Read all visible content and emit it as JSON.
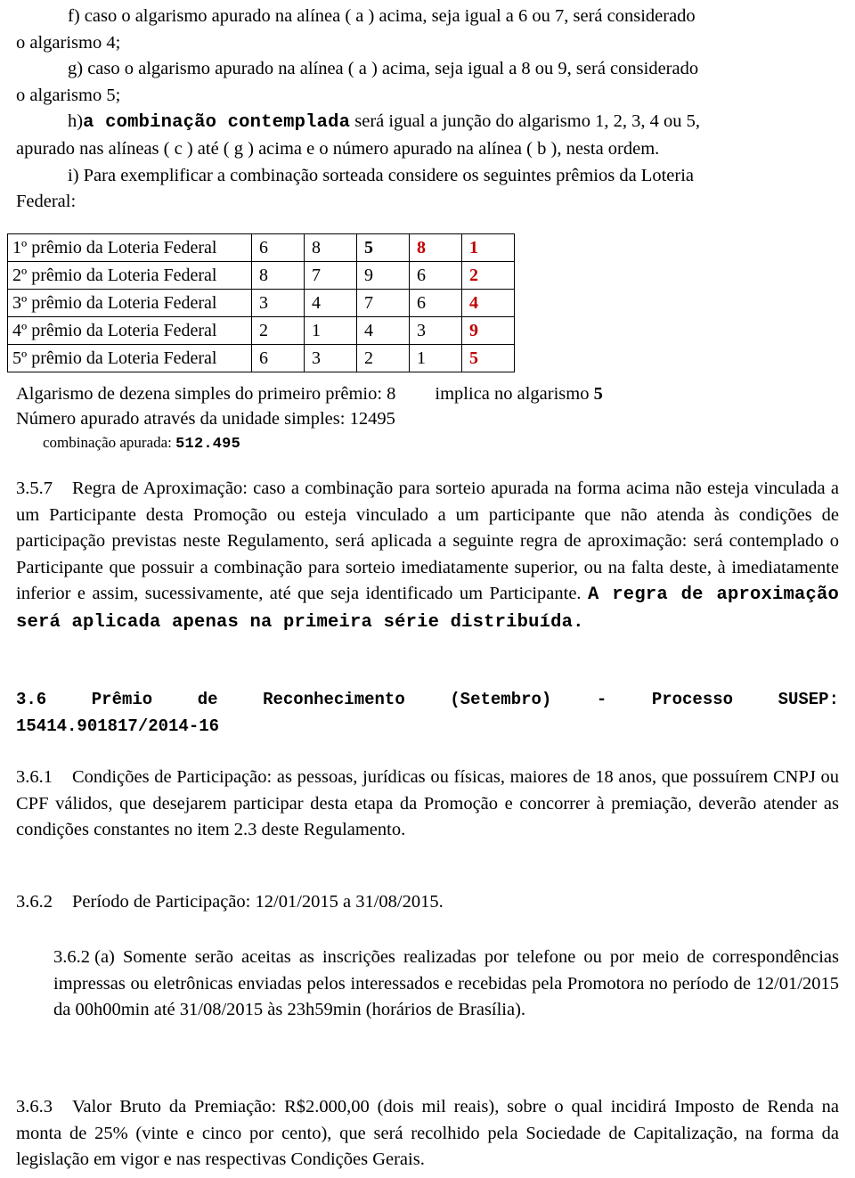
{
  "colors": {
    "text": "#000000",
    "accent_red": "#C00000",
    "page_background": "#FFFFFF",
    "table_border": "#000000"
  },
  "alineas": {
    "f_line1": "f) caso o algarismo apurado na alínea ( a ) acima, seja igual a 6 ou 7, será considerado",
    "f_line2": "o algarismo 4;",
    "g_line1": "g) caso o algarismo apurado na alínea ( a ) acima, seja igual a 8 ou 9, será considerado",
    "g_line2": "o algarismo 5;",
    "h_marker": "h)",
    "h_bold": "a combinação contemplada",
    "h_rest": " será igual a junção do algarismo 1, 2, 3, 4 ou 5,",
    "h_line2": "apurado nas alíneas ( c ) até ( g ) acima e o número apurado na alínea ( b ), nesta ordem.",
    "i_line1": "i) Para exemplificar a combinação sorteada considere os seguintes prêmios da Loteria",
    "i_line2": "Federal:"
  },
  "lottery_table": {
    "rows": [
      {
        "label": "1º prêmio da Loteria Federal",
        "digits": [
          "6",
          "8",
          "5",
          "8",
          "1"
        ],
        "styles": [
          "plain",
          "plain",
          "bold",
          "red",
          "red"
        ]
      },
      {
        "label": "2º prêmio da Loteria Federal",
        "digits": [
          "8",
          "7",
          "9",
          "6",
          "2"
        ],
        "styles": [
          "plain",
          "plain",
          "plain",
          "plain",
          "red"
        ]
      },
      {
        "label": "3º prêmio da Loteria Federal",
        "digits": [
          "3",
          "4",
          "7",
          "6",
          "4"
        ],
        "styles": [
          "plain",
          "plain",
          "plain",
          "plain",
          "red"
        ]
      },
      {
        "label": "4º prêmio da Loteria Federal",
        "digits": [
          "2",
          "1",
          "4",
          "3",
          "9"
        ],
        "styles": [
          "plain",
          "plain",
          "plain",
          "plain",
          "red"
        ]
      },
      {
        "label": "5º prêmio da Loteria Federal",
        "digits": [
          "6",
          "3",
          "2",
          "1",
          "5"
        ],
        "styles": [
          "plain",
          "plain",
          "plain",
          "plain",
          "red"
        ]
      }
    ]
  },
  "explicacao": {
    "linha1_a": "Algarismo de dezena simples do primeiro prêmio: 8",
    "linha1_b_prefix": "implica no algarismo ",
    "linha1_b_bold": "5",
    "linha2": "Número apurado através da unidade simples: 12495",
    "linha3_label": "combinação apurada: ",
    "linha3_value": "512.495"
  },
  "sec_357": {
    "number": "3.5.7",
    "text_before_bold": "Regra de Aproximação: caso a combinação para sorteio apurada na forma acima não esteja vinculada a um Participante desta Promoção ou esteja vinculado a um participante que não atenda às condições de participação previstas neste Regulamento, será aplicada a seguinte regra de aproximação: será contemplado o Participante que possuir a combinação para sorteio imediatamente superior, ou na falta deste, à imediatamente inferior e assim, sucessivamente, até que seja identificado um Participante. ",
    "bold_text": "A regra de aproximação será aplicada apenas na primeira série distribuída."
  },
  "sec_36": {
    "number": "3.6",
    "title_words": [
      "Prêmio",
      "de",
      "Reconhecimento",
      "(Setembro)",
      "-",
      "Processo",
      "SUSEP:"
    ],
    "line2": "15414.901817/2014-16"
  },
  "sec_361": {
    "number": "3.6.1",
    "text": "Condições de Participação: as pessoas, jurídicas ou físicas, maiores de 18 anos, que possuírem CNPJ ou CPF válidos, que desejarem participar desta etapa da Promoção e concorrer à premiação, deverão atender as condições constantes no item 2.3 deste Regulamento."
  },
  "sec_362": {
    "number": "3.6.2",
    "text": "Período de Participação: 12/01/2015 a 31/08/2015."
  },
  "sec_362a": {
    "number": "3.6.2 (a)",
    "text": "Somente serão aceitas as inscrições realizadas por telefone ou por meio de correspondências impressas ou eletrônicas enviadas pelos interessados e recebidas pela Promotora no período de 12/01/2015 da 00h00min até 31/08/2015 às 23h59min (horários de Brasília)."
  },
  "sec_363": {
    "number": "3.6.3",
    "text": "Valor Bruto da Premiação: R$2.000,00 (dois mil reais), sobre o qual incidirá Imposto de Renda na monta de 25% (vinte e cinco por cento), que será recolhido pela Sociedade de Capitalização, na forma da legislação em vigor e nas respectivas Condições Gerais."
  }
}
